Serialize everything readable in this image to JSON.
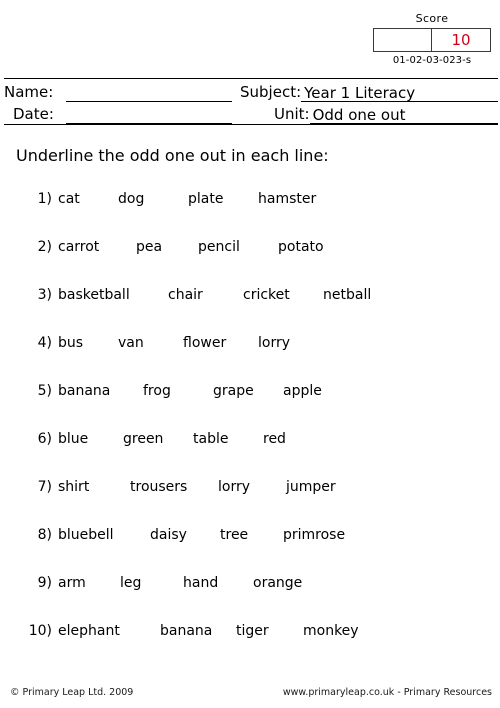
{
  "score": {
    "label": "Score",
    "blank_cell": "",
    "value": "10",
    "value_color": "#d0021b",
    "serial": "01-02-03-023-s"
  },
  "header": {
    "name_label": "Name:",
    "name_value": "",
    "date_label": "Date:",
    "date_value": "",
    "subject_label": "Subject:",
    "subject_value": "Year 1 Literacy",
    "unit_label": "Unit:",
    "unit_value": "Odd one out"
  },
  "instruction": "Underline the odd one out in each line:",
  "questions": [
    {
      "number": "1)",
      "words": [
        "cat",
        "dog",
        "plate",
        "hamster"
      ],
      "offsets": [
        0,
        60,
        130,
        200
      ]
    },
    {
      "number": "2)",
      "words": [
        "carrot",
        "pea",
        "pencil",
        "potato"
      ],
      "offsets": [
        0,
        78,
        140,
        220
      ]
    },
    {
      "number": "3)",
      "words": [
        "basketball",
        "chair",
        "cricket",
        "netball"
      ],
      "offsets": [
        0,
        110,
        185,
        265
      ]
    },
    {
      "number": "4)",
      "words": [
        "bus",
        "van",
        "flower",
        "lorry"
      ],
      "offsets": [
        0,
        60,
        125,
        200
      ]
    },
    {
      "number": "5)",
      "words": [
        "banana",
        "frog",
        "grape",
        "apple"
      ],
      "offsets": [
        0,
        85,
        155,
        225
      ]
    },
    {
      "number": "6)",
      "words": [
        "blue",
        "green",
        "table",
        "red"
      ],
      "offsets": [
        0,
        65,
        135,
        205
      ]
    },
    {
      "number": "7)",
      "words": [
        "shirt",
        "trousers",
        "lorry",
        "jumper"
      ],
      "offsets": [
        0,
        72,
        160,
        228
      ]
    },
    {
      "number": "8)",
      "words": [
        "bluebell",
        "daisy",
        "tree",
        "primrose"
      ],
      "offsets": [
        0,
        92,
        162,
        225
      ]
    },
    {
      "number": "9)",
      "words": [
        "arm",
        "leg",
        "hand",
        "orange"
      ],
      "offsets": [
        0,
        62,
        125,
        195
      ]
    },
    {
      "number": "10)",
      "words": [
        "elephant",
        "banana",
        "tiger",
        "monkey"
      ],
      "offsets": [
        0,
        102,
        178,
        245
      ]
    }
  ],
  "footer": {
    "copyright": "© Primary Leap Ltd. 2009",
    "website": "www.primaryleap.co.uk  -  Primary Resources"
  }
}
